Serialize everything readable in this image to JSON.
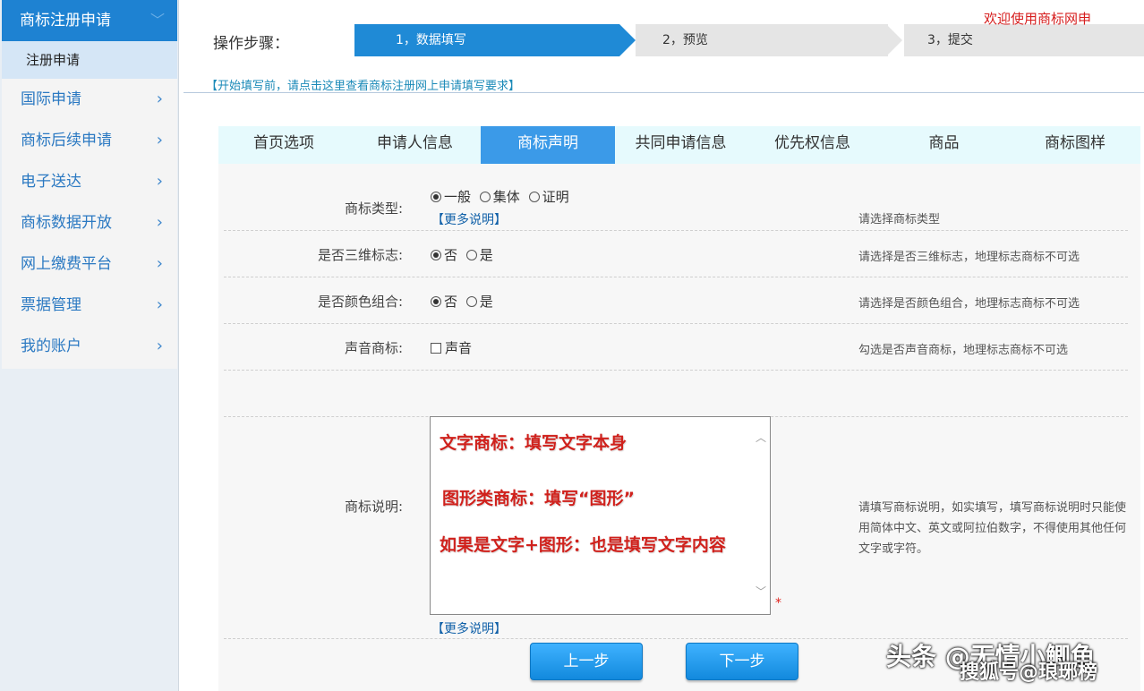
{
  "sidebar": {
    "active_section": "商标注册申请",
    "active_sub": "注册申请",
    "items": [
      {
        "label": "国际申请"
      },
      {
        "label": "商标后续申请"
      },
      {
        "label": "电子送达"
      },
      {
        "label": "商标数据开放"
      },
      {
        "label": "网上缴费平台"
      },
      {
        "label": "票据管理"
      },
      {
        "label": "我的账户"
      }
    ]
  },
  "header": {
    "steps_label": "操作步骤：",
    "steps": [
      {
        "label": "1，数据填写",
        "active": true
      },
      {
        "label": "2，预览",
        "active": false
      },
      {
        "label": "3，提交",
        "active": false
      }
    ],
    "welcome": "欢迎使用商标网申",
    "notice": "【开始填写前，请点击这里查看商标注册网上申请填写要求】"
  },
  "tabs": [
    {
      "label": "首页选项"
    },
    {
      "label": "申请人信息"
    },
    {
      "label": "商标声明",
      "active": true
    },
    {
      "label": "共同申请信息"
    },
    {
      "label": "优先权信息"
    },
    {
      "label": "商品"
    },
    {
      "label": "商标图样"
    }
  ],
  "form": {
    "type": {
      "label": "商标类型:",
      "options": [
        "一般",
        "集体",
        "证明"
      ],
      "selected": "一般",
      "more": "【更多说明】",
      "hint": "请选择商标类型"
    },
    "three_d": {
      "label": "是否三维标志:",
      "options": [
        "否",
        "是"
      ],
      "selected": "否",
      "hint": "请选择是否三维标志，地理标志商标不可选"
    },
    "color": {
      "label": "是否颜色组合:",
      "options": [
        "否",
        "是"
      ],
      "selected": "否",
      "hint": "请选择是否颜色组合，地理标志商标不可选"
    },
    "sound": {
      "label": "声音商标:",
      "checkbox": "声音",
      "checked": false,
      "hint": "勾选是否声音商标，地理标志商标不可选"
    },
    "description": {
      "label": "商标说明:",
      "lines": [
        "文字商标：填写文字本身",
        "图形类商标：填写“图形”",
        "如果是文字+图形：也是填写文字内容"
      ],
      "required_mark": "*",
      "more": "【更多说明】",
      "hint": "请填写商标说明，如实填写，填写商标说明时只能使用简体中文、英文或阿拉伯数字，不得使用其他任何文字或字符。"
    }
  },
  "buttons": {
    "prev": "上一步",
    "next": "下一步"
  },
  "watermark": {
    "line1": "头条 @无情小鲫鱼",
    "line2": "搜狐号@琅琊榜"
  },
  "colors": {
    "primary": "#1e82d2",
    "tab_active": "#3b9ae8",
    "warning_red": "#d0211c"
  }
}
